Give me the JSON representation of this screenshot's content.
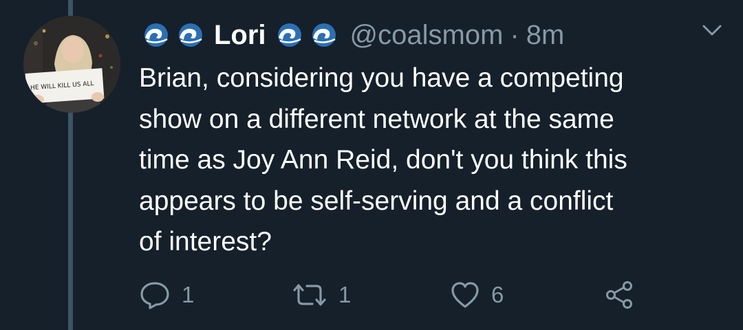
{
  "author": {
    "name": "Lori",
    "handle": "@coalsmom",
    "separator": "·",
    "time": "8m",
    "avatar_sign_text": "HE WILL KILL US ALL",
    "name_decorations": [
      "water-wave-emoji",
      "water-wave-emoji",
      "water-wave-emoji",
      "water-wave-emoji"
    ]
  },
  "tweet": {
    "lines": [
      "Brian, considering you have a competing",
      "show on a different network at the same",
      "time as Joy Ann Reid, don't you think this",
      "appears to be self-serving and a conflict",
      "of interest?"
    ]
  },
  "actions": {
    "replies": "1",
    "retweets": "1",
    "likes": "6"
  },
  "colors": {
    "background": "#15202b",
    "secondary_text": "#8899a6",
    "primary_text": "#ffffff",
    "thread_line": "#3d5466"
  }
}
